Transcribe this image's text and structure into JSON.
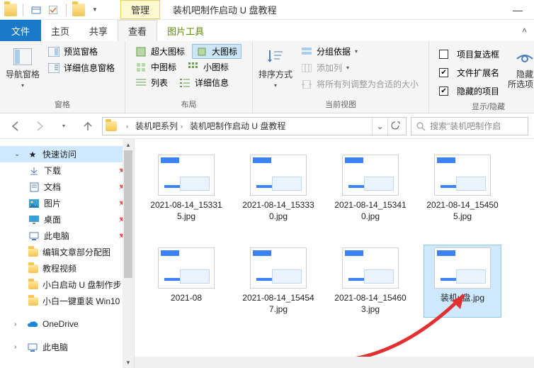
{
  "titlebar": {
    "manage_tab": "管理",
    "title": "装机吧制作启动 U 盘教程"
  },
  "tabs": {
    "file": "文件",
    "home": "主页",
    "share": "共享",
    "view": "查看",
    "picture_tools": "图片工具"
  },
  "ribbon": {
    "panes": {
      "nav_pane": "导航窗格",
      "preview_pane": "预览窗格",
      "details_pane": "详细信息窗格",
      "label": "窗格"
    },
    "layout": {
      "extra_large": "超大图标",
      "large": "大图标",
      "medium": "中图标",
      "small": "小图标",
      "list": "列表",
      "details": "详细信息",
      "label": "布局"
    },
    "current_view": {
      "sort_by": "排序方式",
      "group_by": "分组依据",
      "add_columns": "添加列",
      "size_all_columns": "将所有列调整为合适的大小",
      "label": "当前视图"
    },
    "show_hide": {
      "item_checkboxes": "项目复选框",
      "file_ext": "文件扩展名",
      "hidden_items": "隐藏的项目",
      "hide": "隐藏\n所选项目",
      "label": "显示/隐藏"
    },
    "options": "选"
  },
  "address": {
    "crumbs": [
      "装机吧系列",
      "装机吧制作启动 U 盘教程"
    ],
    "search_placeholder": "搜索\"装机吧制作启"
  },
  "nav": {
    "quick_access": "快速访问",
    "downloads": "下载",
    "documents": "文档",
    "pictures": "图片",
    "desktop": "桌面",
    "this_pc": "此电脑",
    "edit_article": "编辑文章部分配图",
    "tutorial_video": "教程视频",
    "xiaobai_start": "小白启动 U 盘制作步",
    "xiaobai_reinstall": "小白一键重装 Win10",
    "onedrive": "OneDrive",
    "this_pc2": "此电脑"
  },
  "files": [
    {
      "name": "2021-08-14_153315.jpg"
    },
    {
      "name": "2021-08-14_153330.jpg"
    },
    {
      "name": "2021-08-14_153410.jpg"
    },
    {
      "name": "2021-08-14_154505.jpg"
    },
    {
      "name": "2021-08"
    },
    {
      "name": "2021-08-14_154547.jpg"
    },
    {
      "name": "2021-08-14_154603.jpg"
    },
    {
      "name": "装机u盘.jpg",
      "selected": true
    }
  ]
}
